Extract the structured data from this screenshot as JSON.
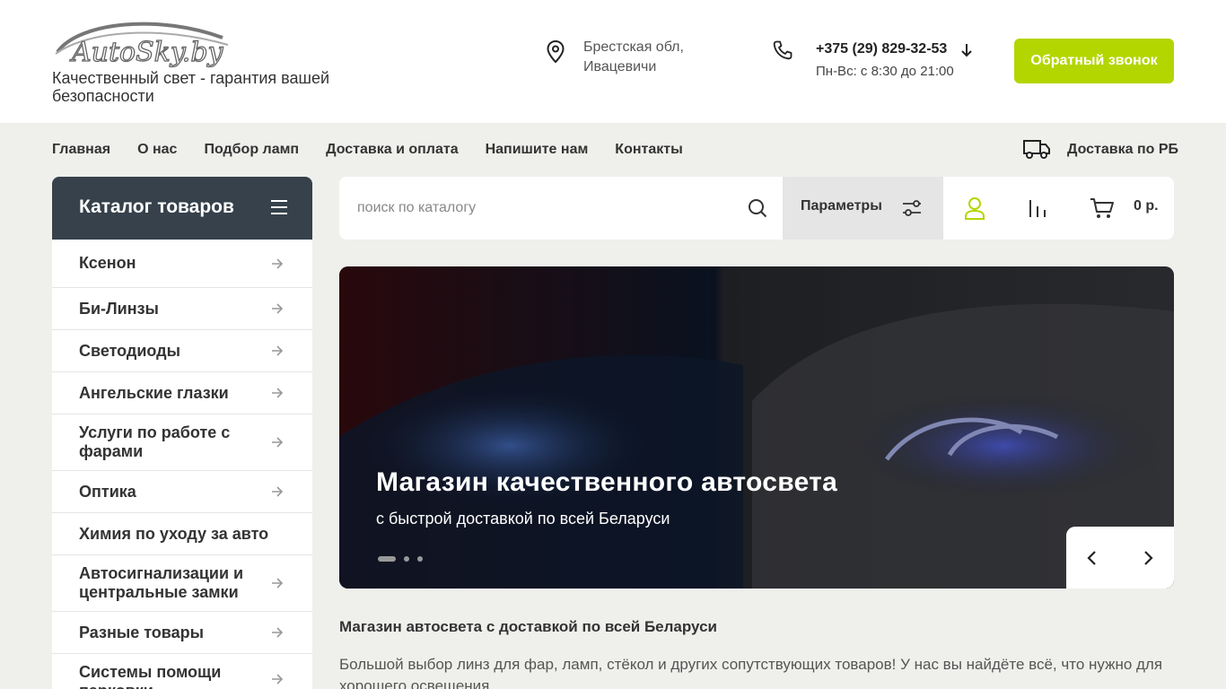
{
  "header": {
    "logo_text": "AutoSky.by",
    "tagline": "Качественный свет - гарантия вашей безопасности",
    "location_line1": "Брестская обл,",
    "location_line2": "Ивацевичи",
    "phone": "+375 (29) 829-32-53",
    "hours": "Пн-Вс: с 8:30 до 21:00",
    "callback_label": "Обратный звонок",
    "accent_color": "#b3d600"
  },
  "nav": {
    "items": [
      "Главная",
      "О нас",
      "Подбор ламп",
      "Доставка и оплата",
      "Напишите нам",
      "Контакты"
    ],
    "delivery_label": "Доставка по РБ"
  },
  "catalog": {
    "title": "Каталог товаров",
    "items": [
      {
        "label": "Ксенон",
        "arrow": true
      },
      {
        "label": "Би-Линзы",
        "arrow": true
      },
      {
        "label": "Светодиоды",
        "arrow": true
      },
      {
        "label": "Ангельские глазки",
        "arrow": true
      },
      {
        "label": "Услуги по работе с фарами",
        "arrow": true
      },
      {
        "label": "Оптика",
        "arrow": true
      },
      {
        "label": "Химия по уходу за авто",
        "arrow": false
      },
      {
        "label": "Автосигнализации и центральные замки",
        "arrow": true
      },
      {
        "label": "Разные товары",
        "arrow": true
      },
      {
        "label": "Системы помощи парковки",
        "arrow": true
      }
    ]
  },
  "search": {
    "placeholder": "поиск по каталогу",
    "params_label": "Параметры",
    "cart_total": "0 р."
  },
  "banner": {
    "title": "Магазин качественного автосвета",
    "subtitle": "с быстрой доставкой по всей Беларуси",
    "slide_count": 3,
    "active_slide": 1
  },
  "about": {
    "title": "Магазин автосвета с доставкой по всей Беларуси",
    "text": "Большой выбор линз для фар, ламп, стёкол и других сопутствующих товаров! У нас вы найдёте всё, что нужно для хорошего освещения."
  }
}
